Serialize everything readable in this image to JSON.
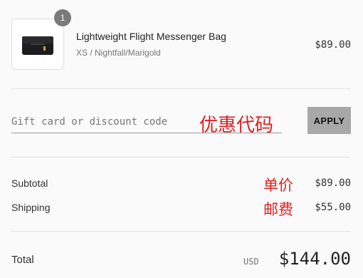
{
  "cart_item": {
    "quantity": "1",
    "name": "Lightweight Flight Messenger Bag",
    "variant": "XS / Nightfall/Marigold",
    "price": "$89.00",
    "image_icon": "messenger-bag-image"
  },
  "discount": {
    "placeholder": "Gift card or discount code",
    "value": "",
    "annotation": "优惠代码",
    "apply_label": "APPLY"
  },
  "summary": {
    "subtotal_label": "Subtotal",
    "subtotal_annotation": "单价",
    "subtotal_value": "$89.00",
    "shipping_label": "Shipping",
    "shipping_annotation": "邮费",
    "shipping_value": "$55.00",
    "total_label": "Total",
    "currency": "USD",
    "total_value": "$144.00"
  },
  "colors": {
    "annotation": "#e02020",
    "apply_button": "#a8a8a8",
    "badge": "#7a7a7a"
  }
}
